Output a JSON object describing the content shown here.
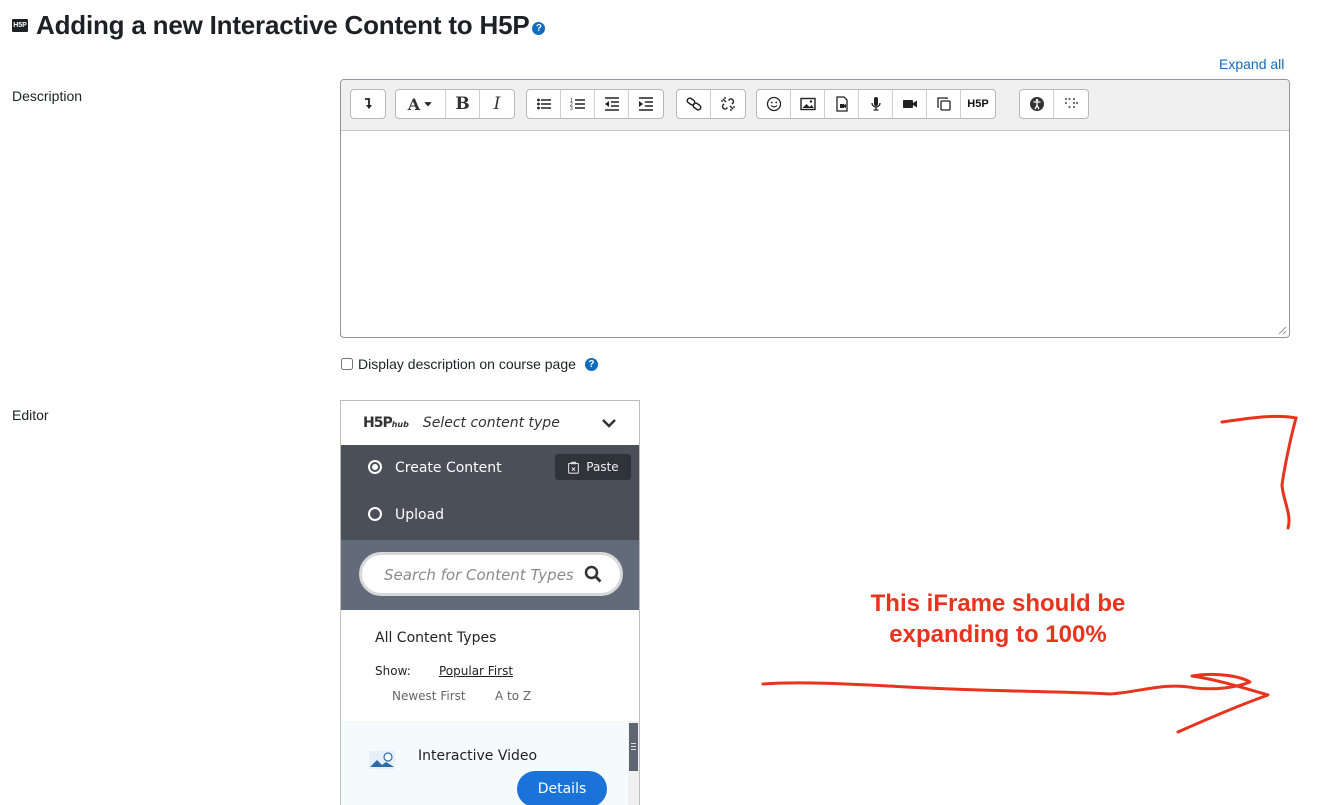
{
  "header": {
    "title": "Adding a new Interactive Content to H5P",
    "help_icon": "question-circle-icon",
    "logo": "H5P"
  },
  "expand_all": "Expand all",
  "description": {
    "label": "Description",
    "toolbar_icons": [
      "insert-arrow-icon",
      "font-size-icon",
      "bold-icon",
      "italic-icon",
      "bullet-list-icon",
      "numbered-list-icon",
      "outdent-icon",
      "indent-icon",
      "link-icon",
      "unlink-icon",
      "emoji-icon",
      "image-icon",
      "media-icon",
      "audio-icon",
      "video-icon",
      "copy-icon",
      "h5p-icon",
      "accessibility-checker-icon",
      "screen-reader-helper-icon"
    ],
    "bold_label": "B",
    "italic_label": "I",
    "font_label": "A",
    "h5p_label": "H5P",
    "display_on_course_page": "Display description on course page"
  },
  "editor": {
    "label": "Editor",
    "hub": {
      "logo": "H5P",
      "logo_sub": "hub",
      "select_label": "Select content type",
      "create_content": "Create Content",
      "upload": "Upload",
      "paste": "Paste",
      "search_placeholder": "Search for Content Types",
      "all_content_types": "All Content Types",
      "show_label": "Show:",
      "sort_popular": "Popular First",
      "sort_newest": "Newest First",
      "sort_az": "A to Z",
      "items": [
        {
          "title": "Interactive Video",
          "details": "Details"
        }
      ]
    }
  },
  "annotation": {
    "line1": "This iFrame should be",
    "line2": "expanding to 100%",
    "color": "#e8331e"
  }
}
